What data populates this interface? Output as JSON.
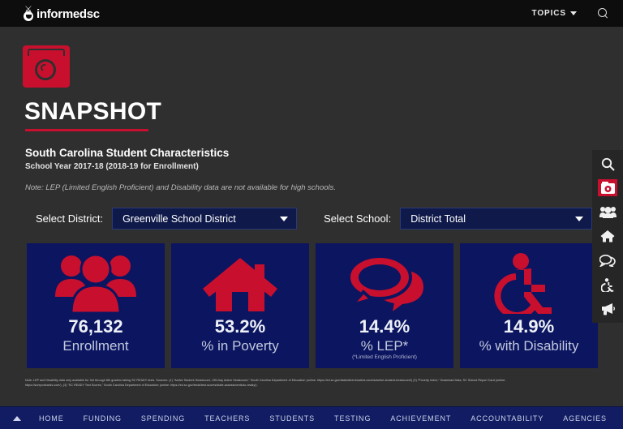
{
  "topbar": {
    "logo_text": "informedsc",
    "topics_label": "TOPICS",
    "search_icon": "search-icon",
    "caret_icon": "chevron-down-icon"
  },
  "hero": {
    "icon": "camera-icon",
    "title": "SNAPSHOT",
    "subtitle": "South Carolina Student Characteristics",
    "school_year": "School Year 2017-18 (2018-19 for Enrollment)",
    "note": "Note: LEP (Limited English Proficient) and Disability data are not available for high schools."
  },
  "selectors": {
    "district": {
      "label": "Select District:",
      "value": "Greenville School District"
    },
    "school": {
      "label": "Select School:",
      "value": "District Total"
    }
  },
  "cards": [
    {
      "icon": "people-group-icon",
      "value": "76,132",
      "label": "Enrollment",
      "sub": ""
    },
    {
      "icon": "house-icon",
      "value": "53.2%",
      "label": "% in Poverty",
      "sub": ""
    },
    {
      "icon": "speech-bubbles-icon",
      "value": "14.4%",
      "label": "% LEP*",
      "sub": "(*Limited English Proficient)"
    },
    {
      "icon": "wheelchair-accessibility-icon",
      "value": "14.9%",
      "label": "% with Disability",
      "sub": ""
    }
  ],
  "footnote": {
    "line1": "Note: LEP and Disability data only available for 3rd through 8th graders taking SC READY tests. Sources: (1) \"Active Student Headcount, 135-Day Active Headcount,\" South Carolina Department of Education (online: https://ed.sc.gov/data/other/student-counts/active-student-headcount/) (2) \"Poverty Index,\" Download Data, SC School Report Card (online:",
    "line2": "https://screportcards.com/), (3) \"SC READY Test Scores,\" South Carolina Department of Education (online: https://ed.sc.gov/tests/test-scores/state-assessments/sc-ready/)."
  },
  "rail": [
    {
      "icon": "search-icon",
      "name": "rail-search"
    },
    {
      "icon": "camera-icon",
      "name": "rail-snapshot"
    },
    {
      "icon": "people-icon",
      "name": "rail-students"
    },
    {
      "icon": "home-icon",
      "name": "rail-home"
    },
    {
      "icon": "chat-icon",
      "name": "rail-chat"
    },
    {
      "icon": "accessibility-icon",
      "name": "rail-accessibility"
    },
    {
      "icon": "megaphone-icon",
      "name": "rail-announcements"
    }
  ],
  "bottomnav": {
    "toggle_icon": "chevron-up-icon",
    "items": [
      "HOME",
      "FUNDING",
      "SPENDING",
      "TEACHERS",
      "STUDENTS",
      "TESTING",
      "ACHIEVEMENT",
      "ACCOUNTABILITY",
      "AGENCIES"
    ]
  }
}
